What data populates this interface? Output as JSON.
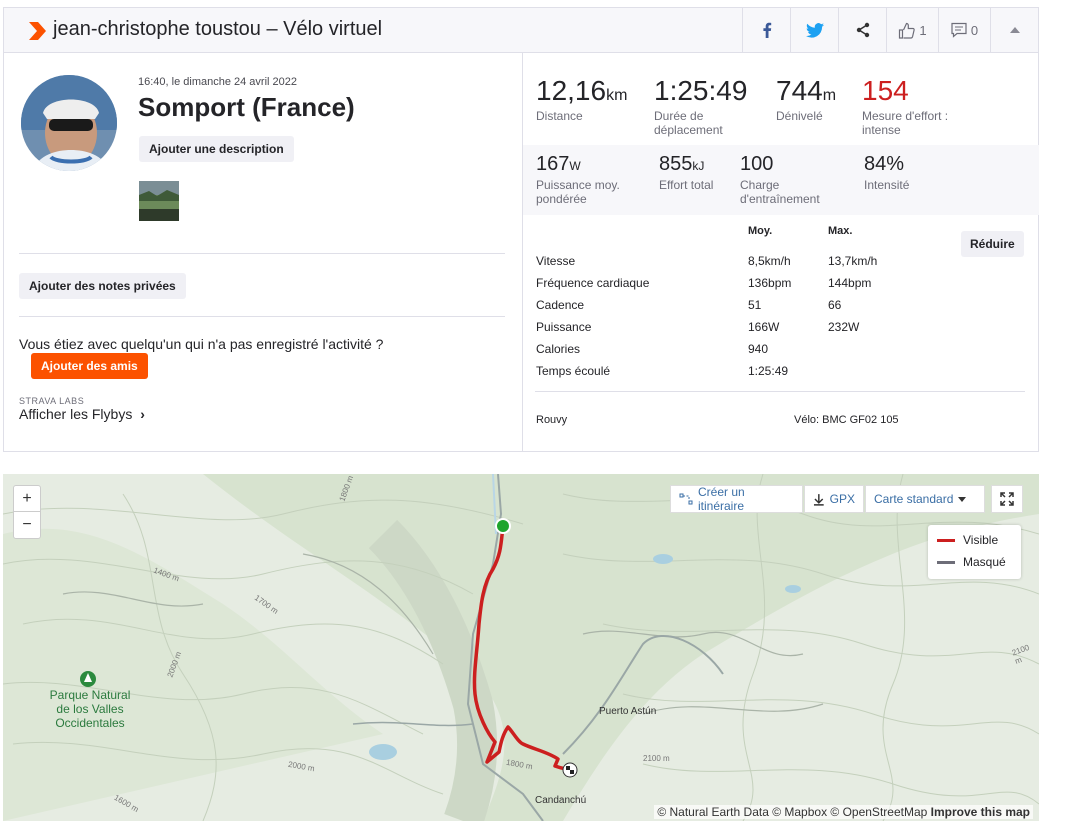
{
  "header": {
    "title": "jean-christophe toustou – Vélo virtuel",
    "kudos_count": "1",
    "comments_count": "0",
    "colors": {
      "brand": "#fc5200"
    }
  },
  "activity": {
    "timestamp": "16:40, le dimanche 24 avril 2022",
    "title": "Somport (France)",
    "add_description": "Ajouter une description",
    "add_private_notes": "Ajouter des notes privées",
    "with_someone_text": "Vous étiez avec quelqu'un qui n'a pas enregistré l'activité ?",
    "add_friends": "Ajouter des amis",
    "labs_label": "STRAVA LABS",
    "flybys_label": "Afficher les Flybys",
    "flybys_arrow": "›"
  },
  "stats": {
    "primary": [
      {
        "value": "12,16",
        "unit": "km",
        "label": "Distance"
      },
      {
        "value": "1:25:49",
        "unit": "",
        "label": "Durée de déplacement"
      },
      {
        "value": "744",
        "unit": "m",
        "label": "Dénivelé"
      },
      {
        "value": "154",
        "unit": "",
        "label": "Mesure d'effort : intense"
      }
    ],
    "secondary": [
      {
        "value": "167",
        "unit": "W",
        "label": "Puissance moy. pondérée"
      },
      {
        "value": "855",
        "unit": "kJ",
        "label": "Effort total"
      },
      {
        "value": "100",
        "unit": "",
        "label": "Charge d'entraînement"
      },
      {
        "value": "84%",
        "unit": "",
        "label": "Intensité"
      }
    ],
    "table": {
      "col_avg": "Moy.",
      "col_max": "Max.",
      "reduce_label": "Réduire",
      "rows": [
        {
          "label": "Vitesse",
          "avg": "8,5km/h",
          "max": "13,7km/h"
        },
        {
          "label": "Fréquence cardiaque",
          "avg": "136bpm",
          "max": "144bpm"
        },
        {
          "label": "Cadence",
          "avg": "51",
          "max": "66"
        },
        {
          "label": "Puissance",
          "avg": "166W",
          "max": "232W"
        },
        {
          "label": "Calories",
          "avg": "940",
          "max": ""
        },
        {
          "label": "Temps écoulé",
          "avg": "1:25:49",
          "max": ""
        }
      ]
    },
    "app": "Rouvy",
    "bike": "Vélo: BMC GF02 105"
  },
  "map": {
    "zoom_in": "+",
    "zoom_out": "−",
    "create_route": "Créer un itinéraire",
    "gpx": "GPX",
    "map_style": "Carte standard",
    "legend_visible": "Visible",
    "legend_hidden": "Masqué",
    "colors": {
      "visible": "#cc1f1f",
      "hidden": "#6d6d78",
      "start": "#1fa52d"
    },
    "labels": {
      "park": "Parque Natural de los Valles Occidentales",
      "puerto": "Puerto Astún",
      "candanchu": "Candanchú",
      "alt_1400": "1400 m",
      "alt_1700": "1700 m",
      "alt_2000": "2000 m",
      "alt_1800": "1800 m",
      "alt_2100": "2100 m",
      "alt_2000b": "2000 m",
      "alt_1800b": "1800 m",
      "alt_2100b": "2100 m",
      "alt_1600": "1600 m"
    },
    "attribution": "© Natural Earth Data © Mapbox © OpenStreetMap",
    "improve": "Improve this map"
  }
}
